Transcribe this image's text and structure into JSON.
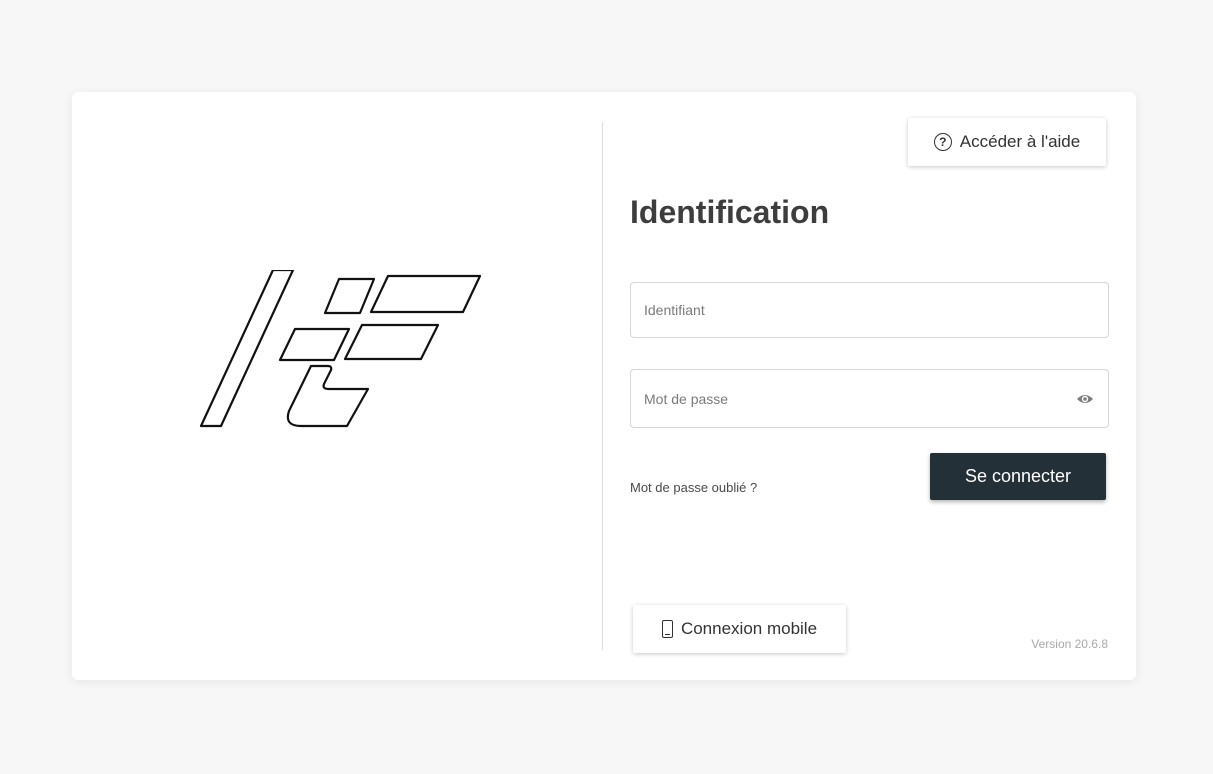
{
  "help": {
    "label": "Accéder à l'aide",
    "icon": "question-circle-icon"
  },
  "login": {
    "title": "Identification",
    "username_placeholder": "Identifiant",
    "username_value": "",
    "password_placeholder": "Mot de passe",
    "password_value": "",
    "password_toggle_icon": "eye-icon",
    "forgot_label": "Mot de passe oublié ?",
    "submit_label": "Se connecter"
  },
  "mobile": {
    "label": "Connexion mobile",
    "icon": "phone-icon"
  },
  "version": "Version 20.6.8",
  "colors": {
    "background": "#f7f7f7",
    "card": "#ffffff",
    "primary_button": "#233038",
    "text": "#3a3a3a",
    "muted": "#a9a9a9"
  }
}
